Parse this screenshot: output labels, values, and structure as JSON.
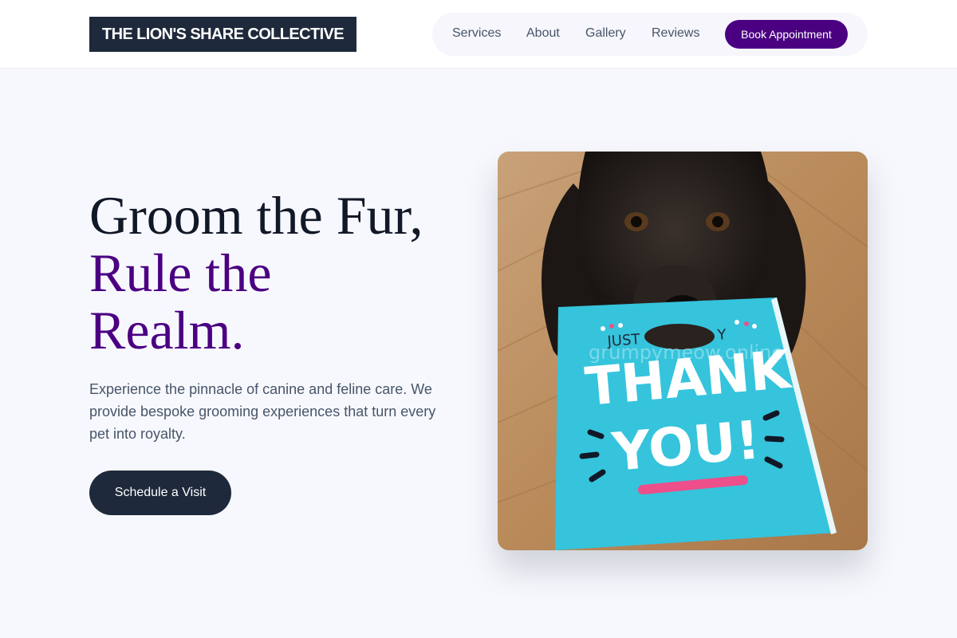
{
  "brand": {
    "name": "THE LION'S SHARE COLLECTIVE"
  },
  "nav": {
    "items": [
      {
        "label": "Services"
      },
      {
        "label": "About"
      },
      {
        "label": "Gallery"
      },
      {
        "label": "Reviews"
      }
    ],
    "cta_label": "Book Appointment"
  },
  "hero": {
    "title_line1": "Groom the Fur,",
    "title_line2": "Rule the",
    "title_line3": "Realm.",
    "description": "Experience the pinnacle of canine and feline care. We provide bespoke grooming experiences that turn every pet into royalty.",
    "cta_label": "Schedule a Visit",
    "image": {
      "card_top_text": "JUST",
      "card_top_text_right": "Y",
      "card_main_line1": "THANK",
      "card_main_line2": "YOU!",
      "watermark": "grumpymeow.online"
    }
  },
  "colors": {
    "primary_dark": "#1e293b",
    "accent_purple": "#4b0082",
    "background": "#f7f8fd",
    "card_cyan": "#35c4dc",
    "underline_pink": "#ec4f8a"
  }
}
